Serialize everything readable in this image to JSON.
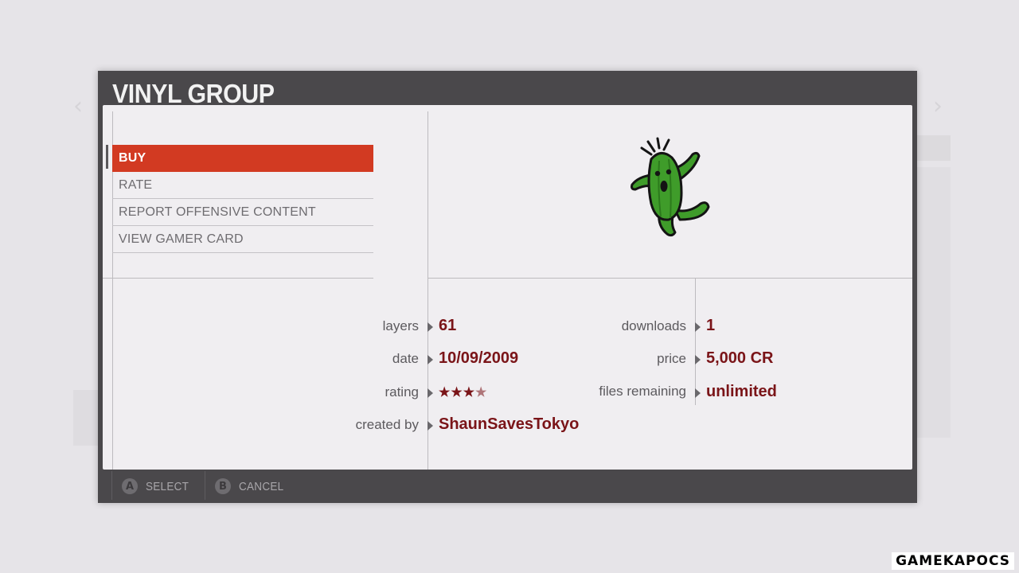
{
  "dialog": {
    "title": "VINYL GROUP"
  },
  "menu": {
    "items": [
      {
        "label": "BUY",
        "active": true
      },
      {
        "label": "RATE",
        "active": false
      },
      {
        "label": "REPORT OFFENSIVE CONTENT",
        "active": false
      },
      {
        "label": "VIEW GAMER CARD",
        "active": false
      }
    ]
  },
  "preview": {
    "icon": "cactuar-icon",
    "body_color": "#3f9c2a"
  },
  "info": {
    "layers": {
      "label": "layers",
      "value": "61"
    },
    "date": {
      "label": "date",
      "value": "10/09/2009"
    },
    "rating": {
      "label": "rating",
      "stars": 4,
      "max": 5
    },
    "created_by": {
      "label": "created by",
      "value": "ShaunSavesTokyo"
    },
    "downloads": {
      "label": "downloads",
      "value": "1"
    },
    "price": {
      "label": "price",
      "value": "5,000 CR"
    },
    "files_remaining": {
      "label": "files remaining",
      "value": "unlimited"
    }
  },
  "footer": {
    "select": {
      "button": "A",
      "label": "SELECT"
    },
    "cancel": {
      "button": "B",
      "label": "CANCEL"
    }
  },
  "watermark": "GAMEKAPOCS",
  "colors": {
    "accent": "#d23a22",
    "value_text": "#7a1418",
    "dialog_frame": "#4a484b"
  }
}
